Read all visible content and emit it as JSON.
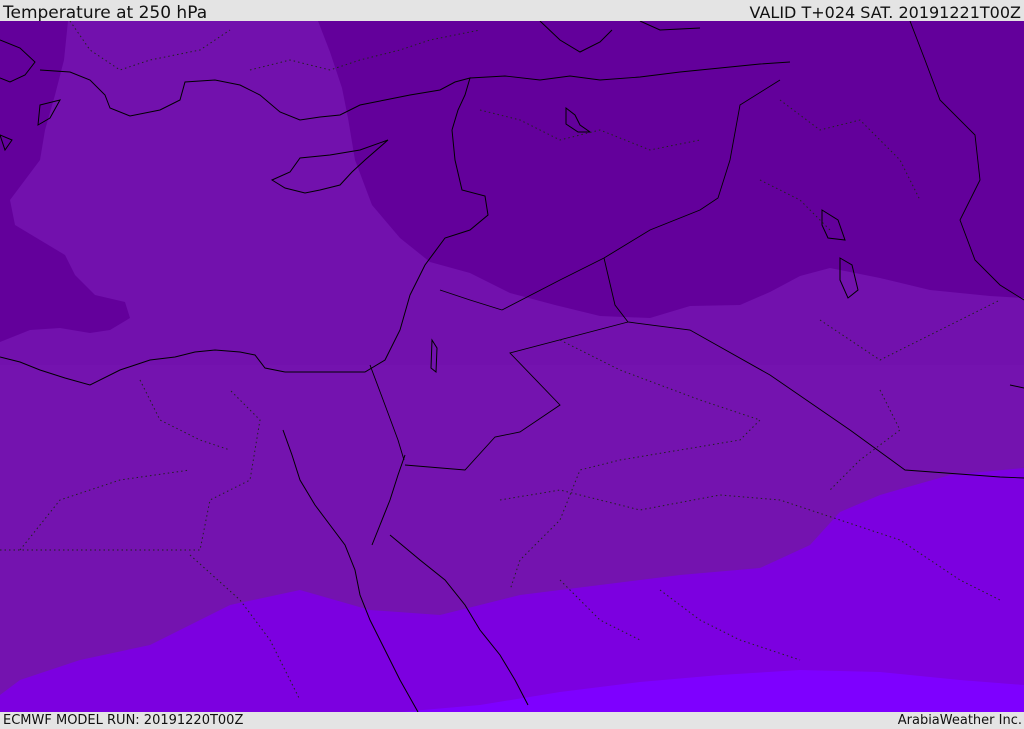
{
  "header": {
    "title": "Temperature at 250 hPa",
    "valid": "VALID T+024 SAT. 20191221T00Z"
  },
  "footer": {
    "model_run": "ECMWF MODEL RUN: 20191220T00Z",
    "credit": "ArabiaWeather Inc."
  },
  "colors": {
    "band_cold": "#63009b",
    "band_mid_upper": "#7211ad",
    "band_mid_lower": "#7413af",
    "band_warm": "#7c00e0",
    "band_warmest": "#7e00ff",
    "frame": "#e4e4e4",
    "lines": "#000000"
  }
}
